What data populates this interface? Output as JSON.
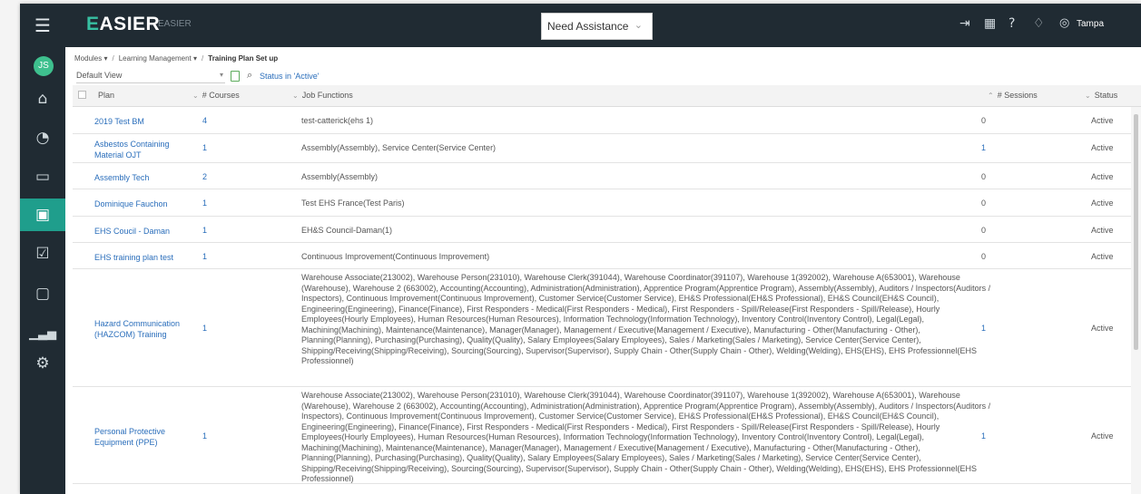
{
  "header": {
    "logo_prefix": "E",
    "logo_rest": "ASIER",
    "tenant": "EASIER",
    "assist_label": "Need Assistance",
    "city": "Tampa",
    "icons": [
      "logout-icon",
      "calendar-icon",
      "help-icon",
      "bell-icon",
      "location-pin-icon"
    ]
  },
  "sidebar": {
    "avatar": "JS",
    "icons": [
      "home-icon",
      "reports-icon",
      "monitor-icon",
      "training-icon",
      "checklist-icon",
      "documents-icon",
      "analytics-icon",
      "settings-icon"
    ],
    "active_index": 3
  },
  "breadcrumb": {
    "modules": "Modules ▾",
    "learning": "Learning Management ▾",
    "current": "Training Plan Set up"
  },
  "toolbar": {
    "view": "Default View",
    "filter": "Status in 'Active'"
  },
  "table": {
    "headers": {
      "plan": "Plan",
      "courses": "# Courses",
      "jobs": "Job Functions",
      "sessions": "# Sessions",
      "status": "Status"
    },
    "rows": [
      {
        "plan": "2019 Test BM",
        "courses": "4",
        "jobs": "test-catterick(ehs 1)",
        "sessions": "0",
        "sessions_link": false,
        "status": "Active"
      },
      {
        "plan": "Asbestos Containing Material OJT",
        "courses": "1",
        "jobs": "Assembly(Assembly), Service Center(Service Center)",
        "sessions": "1",
        "sessions_link": true,
        "status": "Active"
      },
      {
        "plan": "Assembly Tech",
        "courses": "2",
        "jobs": "Assembly(Assembly)",
        "sessions": "0",
        "sessions_link": false,
        "status": "Active"
      },
      {
        "plan": "Dominique Fauchon",
        "courses": "1",
        "jobs": "Test EHS France(Test Paris)",
        "sessions": "0",
        "sessions_link": false,
        "status": "Active"
      },
      {
        "plan": "EHS Coucil - Daman",
        "courses": "1",
        "jobs": "EH&S Council-Daman(1)",
        "sessions": "0",
        "sessions_link": false,
        "status": "Active"
      },
      {
        "plan": "EHS training plan test",
        "courses": "1",
        "jobs": "Continuous Improvement(Continuous Improvement)",
        "sessions": "0",
        "sessions_link": false,
        "status": "Active"
      },
      {
        "plan": "Hazard Communication (HAZCOM) Training",
        "courses": "1",
        "jobs": "Warehouse Associate(213002), Warehouse Person(231010), Warehouse Clerk(391044), Warehouse Coordinator(391107), Warehouse 1(392002), Warehouse A(653001), Warehouse (Warehouse), Warehouse 2 (663002), Accounting(Accounting), Administration(Administration), Apprentice Program(Apprentice Program), Assembly(Assembly), Auditors / Inspectors(Auditors / Inspectors), Continuous Improvement(Continuous Improvement), Customer Service(Customer Service), EH&S Professional(EH&S Professional), EH&S Council(EH&S Council), Engineering(Engineering), Finance(Finance), First Responders - Medical(First Responders - Medical), First Responders - Spill/Release(First Responders - Spill/Release), Hourly Employees(Hourly Employees), Human Resources(Human Resources), Information Technology(Information Technology), Inventory Control(Inventory Control), Legal(Legal), Machining(Machining), Maintenance(Maintenance), Manager(Manager), Management / Executive(Management / Executive), Manufacturing - Other(Manufacturing - Other), Planning(Planning), Purchasing(Purchasing), Quality(Quality), Salary Employees(Salary Employees), Sales / Marketing(Sales / Marketing), Service Center(Service Center), Shipping/Receiving(Shipping/Receiving), Sourcing(Sourcing), Supervisor(Supervisor), Supply Chain - Other(Supply Chain - Other), Welding(Welding), EHS(EHS), EHS Professionnel(EHS Professionnel)",
        "sessions": "1",
        "sessions_link": true,
        "status": "Active"
      },
      {
        "plan": "Personal Protective Equipment (PPE)",
        "courses": "1",
        "jobs": "Warehouse Associate(213002), Warehouse Person(231010), Warehouse Clerk(391044), Warehouse Coordinator(391107), Warehouse 1(392002), Warehouse A(653001), Warehouse (Warehouse), Warehouse 2 (663002), Accounting(Accounting), Administration(Administration), Apprentice Program(Apprentice Program), Assembly(Assembly), Auditors / Inspectors(Auditors / Inspectors), Continuous Improvement(Continuous Improvement), Customer Service(Customer Service), EH&S Professional(EH&S Professional), EH&S Council(EH&S Council), Engineering(Engineering), Finance(Finance), First Responders - Medical(First Responders - Medical), First Responders - Spill/Release(First Responders - Spill/Release), Hourly Employees(Hourly Employees), Human Resources(Human Resources), Information Technology(Information Technology), Inventory Control(Inventory Control), Legal(Legal), Machining(Machining), Maintenance(Maintenance), Manager(Manager), Management / Executive(Management / Executive), Manufacturing - Other(Manufacturing - Other), Planning(Planning), Purchasing(Purchasing), Quality(Quality), Salary Employees(Salary Employees), Sales / Marketing(Sales / Marketing), Service Center(Service Center), Shipping/Receiving(Shipping/Receiving), Sourcing(Sourcing), Supervisor(Supervisor), Supply Chain - Other(Supply Chain - Other), Welding(Welding), EHS(EHS), EHS Professionnel(EHS Professionnel)",
        "sessions": "1",
        "sessions_link": true,
        "status": "Active"
      }
    ]
  },
  "colors": {
    "topbar": "#202b33",
    "accent": "#1f9e8c",
    "link": "#2a6ebb"
  }
}
